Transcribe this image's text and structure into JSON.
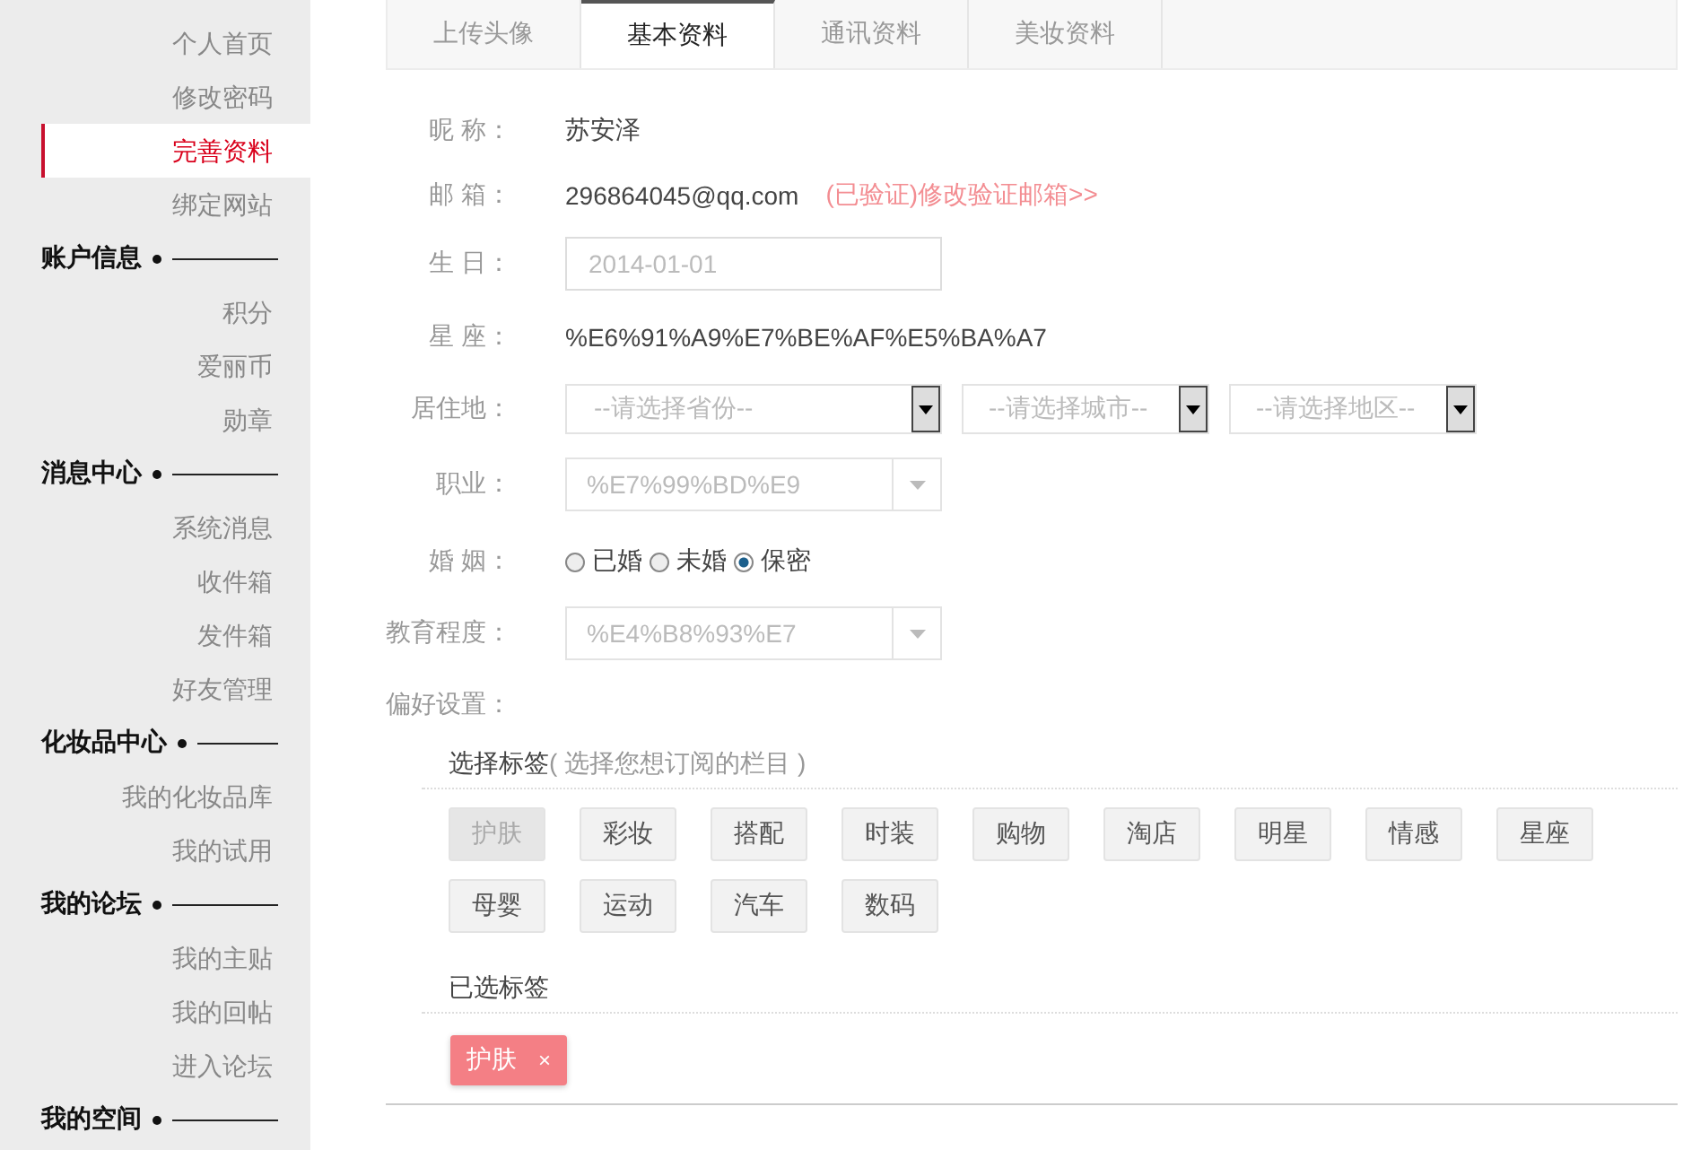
{
  "sidebar": {
    "groups": [
      {
        "items": [
          {
            "label": "个人首页",
            "selected": false
          },
          {
            "label": "修改密码",
            "selected": false
          },
          {
            "label": "完善资料",
            "selected": true
          },
          {
            "label": "绑定网站",
            "selected": false
          }
        ]
      },
      {
        "title": "账户信息",
        "items": [
          {
            "label": "积分",
            "selected": false
          },
          {
            "label": "爱丽币",
            "selected": false
          },
          {
            "label": "勋章",
            "selected": false
          }
        ]
      },
      {
        "title": "消息中心",
        "items": [
          {
            "label": "系统消息",
            "selected": false
          },
          {
            "label": "收件箱",
            "selected": false
          },
          {
            "label": "发件箱",
            "selected": false
          },
          {
            "label": "好友管理",
            "selected": false
          }
        ]
      },
      {
        "title": "化妆品中心",
        "items": [
          {
            "label": "我的化妆品库",
            "selected": false
          },
          {
            "label": "我的试用",
            "selected": false
          }
        ]
      },
      {
        "title": "我的论坛",
        "items": [
          {
            "label": "我的主贴",
            "selected": false
          },
          {
            "label": "我的回帖",
            "selected": false
          },
          {
            "label": "进入论坛",
            "selected": false
          }
        ]
      },
      {
        "title": "我的空间"
      }
    ]
  },
  "tabs": [
    {
      "label": "上传头像",
      "selected": false
    },
    {
      "label": "基本资料",
      "selected": true
    },
    {
      "label": "通讯资料",
      "selected": false
    },
    {
      "label": "美妆资料",
      "selected": false
    }
  ],
  "form": [
    {
      "kind": "text",
      "label": "昵 称：",
      "value": "苏安泽"
    },
    {
      "kind": "email",
      "label": "邮 箱：",
      "value": "296864045@qq.com",
      "link": "(已验证)修改验证邮箱>>"
    },
    {
      "kind": "input",
      "label": "生 日：",
      "value": "2014-01-01"
    },
    {
      "kind": "text",
      "label": "星 座：",
      "value": "%E6%91%A9%E7%BE%AF%E5%BA%A7"
    },
    {
      "kind": "region",
      "label": "居住地：",
      "selects": [
        "--请选择省份--",
        "--请选择城市--",
        "--请选择地区--"
      ]
    },
    {
      "kind": "select",
      "label": "职业：",
      "value": "%E7%99%BD%E9"
    },
    {
      "kind": "radio",
      "label": "婚 姻：",
      "options": [
        {
          "label": "已婚",
          "selected": false
        },
        {
          "label": "未婚",
          "selected": false
        },
        {
          "label": "保密",
          "selected": true
        }
      ]
    },
    {
      "kind": "select",
      "label": "教育程度：",
      "value": "%E4%B8%93%E7"
    }
  ],
  "preferences": {
    "label": "偏好设置：",
    "choose_title": "选择标签",
    "choose_hint": "( 选择您想订阅的栏目 )",
    "tags": [
      {
        "label": "护肤",
        "selected": true
      },
      {
        "label": "彩妆",
        "selected": false
      },
      {
        "label": "搭配",
        "selected": false
      },
      {
        "label": "时装",
        "selected": false
      },
      {
        "label": "购物",
        "selected": false
      },
      {
        "label": "淘店",
        "selected": false
      },
      {
        "label": "明星",
        "selected": false
      },
      {
        "label": "情感",
        "selected": false
      },
      {
        "label": "星座",
        "selected": false
      },
      {
        "label": "母婴",
        "selected": false
      },
      {
        "label": "运动",
        "selected": false
      },
      {
        "label": "汽车",
        "selected": false
      },
      {
        "label": "数码",
        "selected": false
      }
    ],
    "chosen_title": "已选标签",
    "chosen": [
      {
        "label": "护肤",
        "remove": "×"
      }
    ]
  }
}
